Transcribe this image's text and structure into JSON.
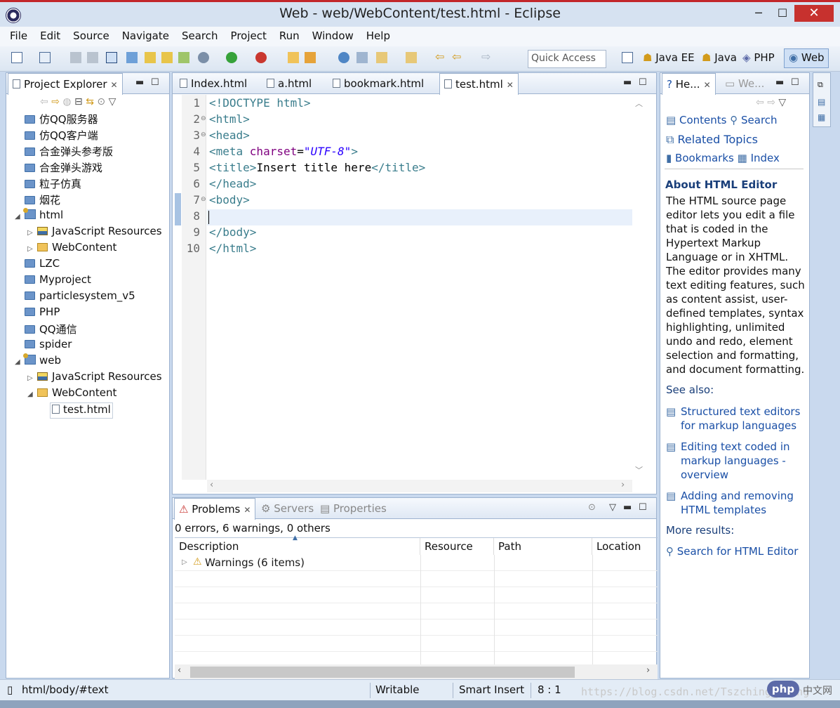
{
  "window": {
    "title": "Web - web/WebContent/test.html - Eclipse",
    "min": "─",
    "max": "☐",
    "close": "✕"
  },
  "menu": [
    "File",
    "Edit",
    "Source",
    "Navigate",
    "Search",
    "Project",
    "Run",
    "Window",
    "Help"
  ],
  "toolbar": {
    "quick_access_placeholder": "Quick Access",
    "perspectives": [
      "Java EE",
      "Java",
      "PHP",
      "Web"
    ]
  },
  "explorer": {
    "tab_label": "Project Explorer",
    "items": [
      {
        "label": "仿QQ服务器"
      },
      {
        "label": "仿QQ客户端"
      },
      {
        "label": "合金弹头参考版"
      },
      {
        "label": "合金弹头游戏"
      },
      {
        "label": "粒子仿真"
      },
      {
        "label": "烟花"
      },
      {
        "label": "html"
      },
      {
        "label": "JavaScript Resources"
      },
      {
        "label": "WebContent"
      },
      {
        "label": "LZC"
      },
      {
        "label": "Myproject"
      },
      {
        "label": "particlesystem_v5"
      },
      {
        "label": "PHP"
      },
      {
        "label": "QQ通信"
      },
      {
        "label": "spider"
      },
      {
        "label": "web"
      },
      {
        "label": "JavaScript Resources"
      },
      {
        "label": "WebContent"
      },
      {
        "label": "test.html"
      }
    ]
  },
  "editor": {
    "tabs": [
      "Index.html",
      "a.html",
      "bookmark.html",
      "test.html"
    ],
    "active_tab": "test.html",
    "line_numbers": [
      "1",
      "2",
      "3",
      "4",
      "5",
      "6",
      "7",
      "8",
      "9",
      "10"
    ],
    "lines": {
      "l1": "<!DOCTYPE html>",
      "l2": "<html>",
      "l3": "<head>",
      "l4_a": "<meta ",
      "l4_b": "charset",
      "l4_c": "=",
      "l4_d": "\"UTF-8\"",
      "l4_e": ">",
      "l5_a": "<title>",
      "l5_b": "Insert title here",
      "l5_c": "</title>",
      "l6": "</head>",
      "l7": "<body>",
      "l8": "",
      "l9": "</body>",
      "l10": "</html>"
    }
  },
  "problems": {
    "tabs": [
      "Problems",
      "Servers",
      "Properties"
    ],
    "summary": "0 errors, 6 warnings, 0 others",
    "columns": [
      "Description",
      "Resource",
      "Path",
      "Location"
    ],
    "rows": [
      {
        "description": "Warnings (6 items)"
      }
    ]
  },
  "help": {
    "tabs": [
      "He...",
      "We..."
    ],
    "nav": {
      "contents": "Contents",
      "search": "Search",
      "related": "Related Topics",
      "bookmarks": "Bookmarks",
      "index": "Index"
    },
    "heading": "About HTML Editor",
    "body": [
      "The HTML source page",
      "editor lets you edit a file",
      "that is coded in the",
      "Hypertext Markup",
      "Language or in XHTML.",
      "The editor provides many",
      "text editing features, such",
      "as content assist, user-",
      "defined templates, syntax",
      "highlighting, unlimited",
      "undo and redo, element",
      "selection and formatting,",
      "and document formatting."
    ],
    "see_also": "See also:",
    "links": [
      [
        "Structured text editors",
        "for markup languages"
      ],
      [
        "Editing text coded in",
        "markup languages -",
        "overview"
      ],
      [
        "Adding and removing",
        "HTML templates"
      ]
    ],
    "more_results": "More results:",
    "search_link": "Search for HTML Editor"
  },
  "status": {
    "path": "html/body/#text",
    "writable": "Writable",
    "insert_mode": "Smart Insert",
    "position": "8 : 1",
    "watermark": "https://blog.csdn.net/Tszching_Leung",
    "badge": "php",
    "badge_suffix": "中文网"
  },
  "colors": {
    "accent": "#1a4fa6",
    "title_bar": "#d6e2f1",
    "close_button": "#c7312e"
  }
}
